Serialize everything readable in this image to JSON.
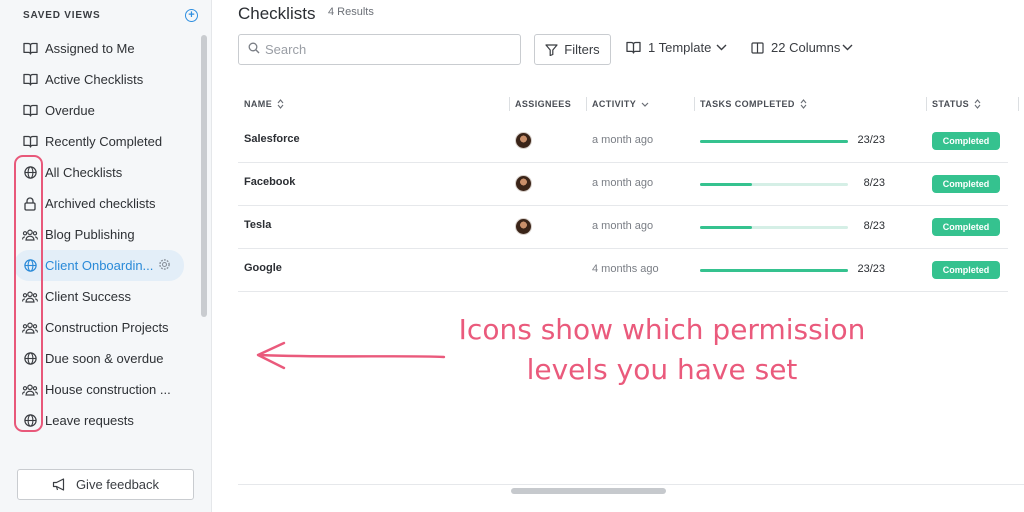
{
  "sidebar": {
    "header": "SAVED VIEWS",
    "items": [
      {
        "label": "Assigned to Me",
        "icon": "book-icon"
      },
      {
        "label": "Active Checklists",
        "icon": "book-icon"
      },
      {
        "label": "Overdue",
        "icon": "book-icon"
      },
      {
        "label": "Recently Completed",
        "icon": "book-icon"
      },
      {
        "label": "All Checklists",
        "icon": "globe-icon"
      },
      {
        "label": "Archived checklists",
        "icon": "lock-icon"
      },
      {
        "label": "Blog Publishing",
        "icon": "users-icon"
      },
      {
        "label": "Client Onboardin...",
        "icon": "globe-icon",
        "active": true
      },
      {
        "label": "Client Success",
        "icon": "users-icon"
      },
      {
        "label": "Construction Projects",
        "icon": "users-icon"
      },
      {
        "label": "Due soon & overdue",
        "icon": "globe-icon"
      },
      {
        "label": "House construction ...",
        "icon": "users-icon"
      },
      {
        "label": "Leave requests",
        "icon": "globe-icon"
      }
    ],
    "feedback_label": "Give feedback"
  },
  "main": {
    "title": "Checklists",
    "results": "4 Results",
    "search_placeholder": "Search",
    "filters_label": "Filters",
    "template_label": "1 Template",
    "columns_label": "22 Columns"
  },
  "table": {
    "headers": [
      "NAME",
      "ASSIGNEES",
      "ACTIVITY",
      "TASKS COMPLETED",
      "STATUS"
    ],
    "rows": [
      {
        "name": "Salesforce",
        "activity": "a month ago",
        "tasks": "23/23",
        "progress": 1.0,
        "status": "Completed",
        "has_assignee": true
      },
      {
        "name": "Facebook",
        "activity": "a month ago",
        "tasks": "8/23",
        "progress": 0.35,
        "status": "Completed",
        "has_assignee": true
      },
      {
        "name": "Tesla",
        "activity": "a month ago",
        "tasks": "8/23",
        "progress": 0.35,
        "status": "Completed",
        "has_assignee": true
      },
      {
        "name": "Google",
        "activity": "4 months ago",
        "tasks": "23/23",
        "progress": 1.0,
        "status": "Completed",
        "has_assignee": false
      }
    ]
  },
  "annotation": {
    "line1": "Icons show which permission",
    "line2": "levels you have set"
  },
  "colors": {
    "accent": "#2a8ad8",
    "success": "#35c28f",
    "annotation": "#ea5a7c"
  }
}
